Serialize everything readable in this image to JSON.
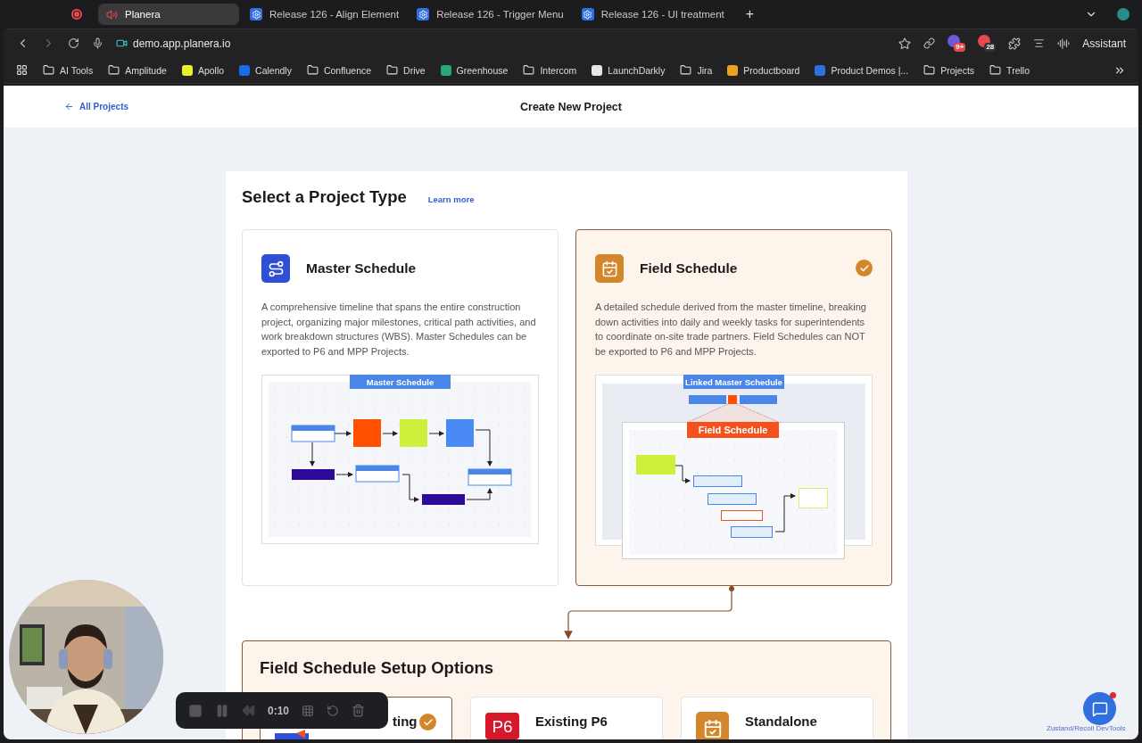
{
  "browser": {
    "tabs": [
      {
        "label": "Planera",
        "selected": true
      },
      {
        "label": "Release 126 - Align Element",
        "selected": false
      },
      {
        "label": "Release 126 - Trigger Menu",
        "selected": false
      },
      {
        "label": "Release 126 - UI treatment",
        "selected": false
      }
    ],
    "new_tab": "+",
    "address": "demo.app.planera.io",
    "extension_badges": [
      "9+",
      "28"
    ],
    "assistant": "Assistant",
    "bookmarks": [
      {
        "label": "AI Tools",
        "kind": "folder"
      },
      {
        "label": "Amplitude",
        "kind": "folder"
      },
      {
        "label": "Apollo",
        "kind": "site",
        "color": "#e8f02a"
      },
      {
        "label": "Calendly",
        "kind": "site",
        "color": "#1a6be8"
      },
      {
        "label": "Confluence",
        "kind": "folder"
      },
      {
        "label": "Drive",
        "kind": "folder"
      },
      {
        "label": "Greenhouse",
        "kind": "site",
        "color": "#2aa876"
      },
      {
        "label": "Intercom",
        "kind": "folder"
      },
      {
        "label": "LaunchDarkly",
        "kind": "site",
        "color": "#e6e6e6"
      },
      {
        "label": "Jira",
        "kind": "folder"
      },
      {
        "label": "Productboard",
        "kind": "site",
        "color": "#f0a020"
      },
      {
        "label": "Product Demos |...",
        "kind": "site",
        "color": "#2f6fe0"
      },
      {
        "label": "Projects",
        "kind": "folder"
      },
      {
        "label": "Trello",
        "kind": "folder"
      }
    ]
  },
  "header": {
    "back_link": "All Projects",
    "title": "Create New Project"
  },
  "project_type": {
    "heading": "Select a Project Type",
    "learn_more": "Learn more",
    "cards": [
      {
        "kind": "master",
        "title": "Master Schedule",
        "description": "A comprehensive timeline that spans the entire construction project, organizing major milestones, critical path activities, and work breakdown structures (WBS). Master Schedules can be exported to P6 and MPP Projects.",
        "selected": false,
        "diagram_labels": [
          "Master Schedule"
        ]
      },
      {
        "kind": "field",
        "title": "Field Schedule",
        "description": "A detailed schedule derived from the master timeline, breaking down activities into daily and weekly tasks for superintendents to coordinate on-site trade partners. Field Schedules can NOT be exported to P6 and MPP Projects.",
        "selected": true,
        "diagram_labels": [
          "Linked Master Schedule",
          "Field Schedule"
        ]
      }
    ]
  },
  "setup": {
    "heading": "Field Schedule Setup Options",
    "options": [
      {
        "kind": "planera",
        "title": "ting",
        "selected": true
      },
      {
        "kind": "p6",
        "logo": "P6",
        "title": "Existing P6",
        "selected": false
      },
      {
        "kind": "standalone",
        "title": "Standalone",
        "selected": false
      }
    ]
  },
  "recorder": {
    "time": "0:10"
  },
  "devtools_label": "Zustand/Recoil DevTools"
}
